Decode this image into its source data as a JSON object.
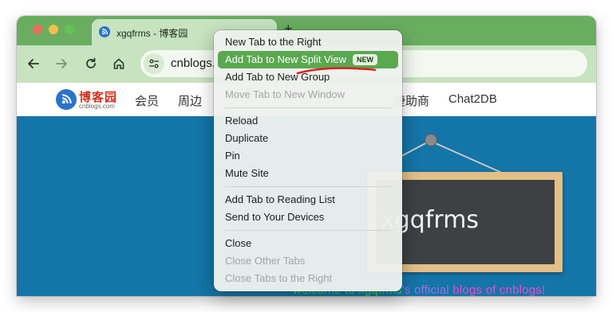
{
  "browser": {
    "tab": {
      "title": "xgqfrms - 博客园"
    },
    "new_tab_label": "+",
    "address": {
      "url": "cnblogs.com/xgqfrms"
    }
  },
  "site": {
    "logo_text": "博客园",
    "logo_subtext": "cnblogs.com",
    "nav": [
      "会员",
      "周边",
      "捷助商",
      "Chat2DB"
    ],
    "board_text": "xgqfrms",
    "welcome_parts": [
      "welcome to xgqfrms",
      "'s official ",
      "blogs of cnblogs!"
    ]
  },
  "context_menu": {
    "items": [
      {
        "label": "New Tab to the Right",
        "state": "normal"
      },
      {
        "label": "Add Tab to New Split View",
        "state": "highlighted",
        "badge": "NEW"
      },
      {
        "label": "Add Tab to New Group",
        "state": "normal"
      },
      {
        "label": "Move Tab to New Window",
        "state": "disabled"
      },
      {
        "label": "Reload",
        "state": "normal"
      },
      {
        "label": "Duplicate",
        "state": "normal"
      },
      {
        "label": "Pin",
        "state": "normal"
      },
      {
        "label": "Mute Site",
        "state": "normal"
      },
      {
        "label": "Add Tab to Reading List",
        "state": "normal"
      },
      {
        "label": "Send to Your Devices",
        "state": "normal"
      },
      {
        "label": "Close",
        "state": "normal"
      },
      {
        "label": "Close Other Tabs",
        "state": "disabled"
      },
      {
        "label": "Close Tabs to the Right",
        "state": "disabled"
      }
    ]
  },
  "icons": [
    "close-window-icon",
    "minimize-window-icon",
    "zoom-window-icon",
    "back-arrow-icon",
    "forward-arrow-icon",
    "reload-icon",
    "home-icon",
    "site-info-icon",
    "cnblogs-logo-icon"
  ],
  "colors": {
    "tab_strip": "#6aad61",
    "toolbar": "#c7e3c0",
    "menu_highlight": "#5aa84f",
    "banner": "#1475a8",
    "annotation_underline": "#e0201a"
  }
}
